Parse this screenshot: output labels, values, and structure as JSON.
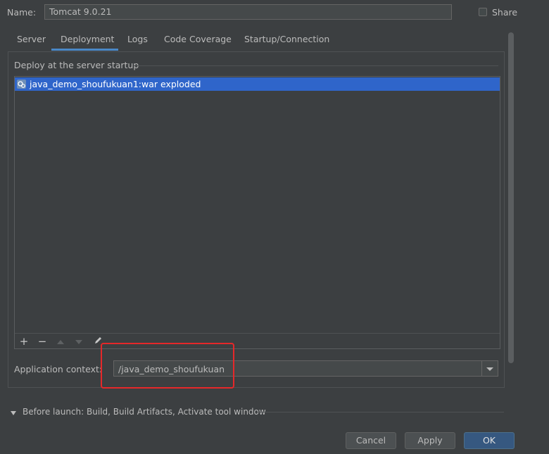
{
  "header": {
    "name_label": "Name:",
    "name_value": "Tomcat 9.0.21",
    "share_label": "Share",
    "share_checked": false
  },
  "tabs": [
    {
      "label": "Server",
      "active": false
    },
    {
      "label": "Deployment",
      "active": true
    },
    {
      "label": "Logs",
      "active": false
    },
    {
      "label": "Code Coverage",
      "active": false
    },
    {
      "label": "Startup/Connection",
      "active": false
    }
  ],
  "deployment": {
    "section_title": "Deploy at the server startup",
    "items": [
      {
        "label": "java_demo_shoufukuan1:war exploded",
        "icon": "artifact-icon",
        "selected": true
      }
    ],
    "toolbar": [
      {
        "icon": "add-icon",
        "enabled": true
      },
      {
        "icon": "remove-icon",
        "enabled": true
      },
      {
        "icon": "move-up-icon",
        "enabled": false
      },
      {
        "icon": "move-down-icon",
        "enabled": false
      },
      {
        "icon": "edit-icon",
        "enabled": true
      }
    ],
    "app_context_label": "Application context:",
    "app_context_value": "/java_demo_shoufukuan"
  },
  "before_launch": {
    "label": "Before launch: Build, Build Artifacts, Activate tool window"
  },
  "buttons": {
    "cancel": "Cancel",
    "apply": "Apply",
    "ok": "OK"
  },
  "colors": {
    "background": "#3c3f41",
    "selection": "#2f65ca",
    "accent_tab": "#4a88c7",
    "highlight_box": "#e5282a",
    "ok_button": "#365880"
  }
}
